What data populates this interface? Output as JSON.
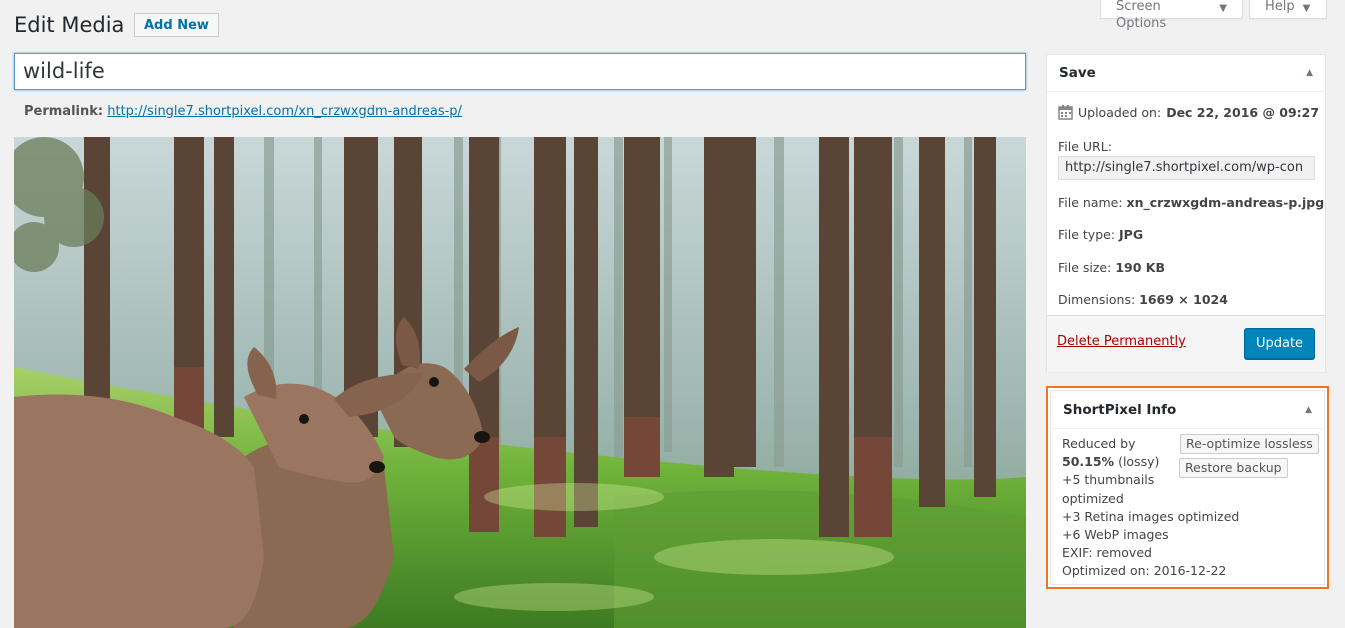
{
  "header": {
    "title": "Edit Media",
    "add_new_label": "Add New",
    "screen_options_label": "Screen Options",
    "help_label": "Help"
  },
  "post": {
    "title": "wild-life",
    "permalink_label": "Permalink:",
    "permalink_url": "http://single7.shortpixel.com/xn_crzwxgdm-andreas-p/"
  },
  "save_box": {
    "title": "Save",
    "uploaded_label": "Uploaded on:",
    "uploaded_value": "Dec 22, 2016 @ 09:27",
    "file_url_label": "File URL:",
    "file_url_value": "http://single7.shortpixel.com/wp-con",
    "file_name_label": "File name:",
    "file_name_value": "xn_crzwxgdm-andreas-p.jpg",
    "file_type_label": "File type:",
    "file_type_value": "JPG",
    "file_size_label": "File size:",
    "file_size_value": "190 KB",
    "dimensions_label": "Dimensions:",
    "dimensions_value": "1669 × 1024",
    "delete_label": "Delete Permanently",
    "update_label": "Update"
  },
  "shortpixel": {
    "title": "ShortPixel Info",
    "reduced_by": "Reduced by",
    "percent": "50.15%",
    "mode": "(lossy)",
    "thumbnails": "+5 thumbnails",
    "optimized": "optimized",
    "retina": "+3 Retina images optimized",
    "webp": "+6 WebP images",
    "exif": "EXIF: removed",
    "optimized_on": "Optimized on: 2016-12-22",
    "reoptimize_label": "Re-optimize lossless",
    "restore_label": "Restore backup"
  },
  "colors": {
    "accent_blue": "#0073aa",
    "button_blue": "#0085ba",
    "highlight_orange": "#f07522",
    "delete_red": "#a00"
  }
}
